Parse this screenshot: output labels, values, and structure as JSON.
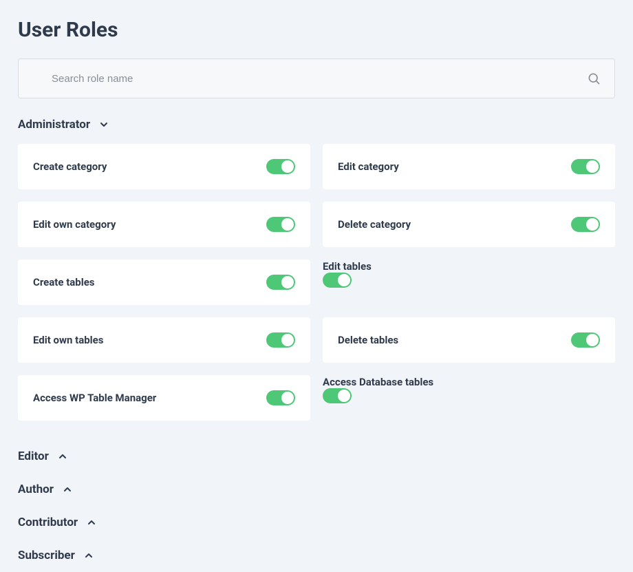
{
  "page_title": "User Roles",
  "search": {
    "placeholder": "Search role name",
    "value": ""
  },
  "roles": [
    {
      "name": "Administrator",
      "expanded": true,
      "permissions": [
        {
          "label": "Create category",
          "enabled": true
        },
        {
          "label": "Edit category",
          "enabled": true
        },
        {
          "label": "Edit own category",
          "enabled": true
        },
        {
          "label": "Delete category",
          "enabled": true
        },
        {
          "label": "Create tables",
          "enabled": true
        },
        {
          "label": "Edit tables",
          "enabled": true
        },
        {
          "label": "Edit own tables",
          "enabled": true
        },
        {
          "label": "Delete tables",
          "enabled": true
        },
        {
          "label": "Access WP Table Manager",
          "enabled": true
        },
        {
          "label": "Access Database tables",
          "enabled": true
        }
      ]
    },
    {
      "name": "Editor",
      "expanded": false
    },
    {
      "name": "Author",
      "expanded": false
    },
    {
      "name": "Contributor",
      "expanded": false
    },
    {
      "name": "Subscriber",
      "expanded": false
    }
  ]
}
